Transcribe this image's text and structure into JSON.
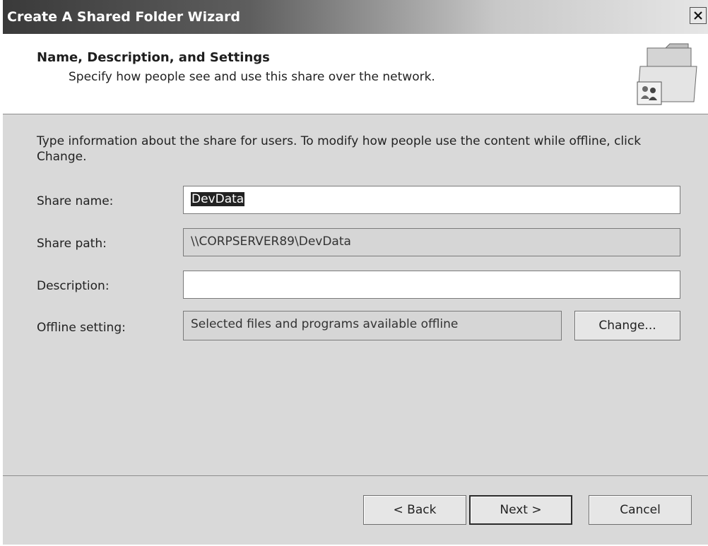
{
  "window": {
    "title": "Create A Shared Folder Wizard",
    "close_symbol": "×"
  },
  "header": {
    "title": "Name, Description, and Settings",
    "subtitle": "Specify how people see and use this share over the network.",
    "icon": "shared-folder-icon"
  },
  "body": {
    "intro": "Type information about the share for users. To modify how people use the content while offline, click Change.",
    "fields": {
      "share_name": {
        "label": "Share name:",
        "value": "DevData"
      },
      "share_path": {
        "label": "Share path:",
        "value": "\\\\CORPSERVER89\\DevData"
      },
      "description": {
        "label": "Description:",
        "value": ""
      },
      "offline_setting": {
        "label": "Offline setting:",
        "value": "Selected files and programs available offline"
      }
    },
    "change_button": "Change..."
  },
  "footer": {
    "back_button": "< Back",
    "next_button": "Next >",
    "cancel_button": "Cancel"
  }
}
